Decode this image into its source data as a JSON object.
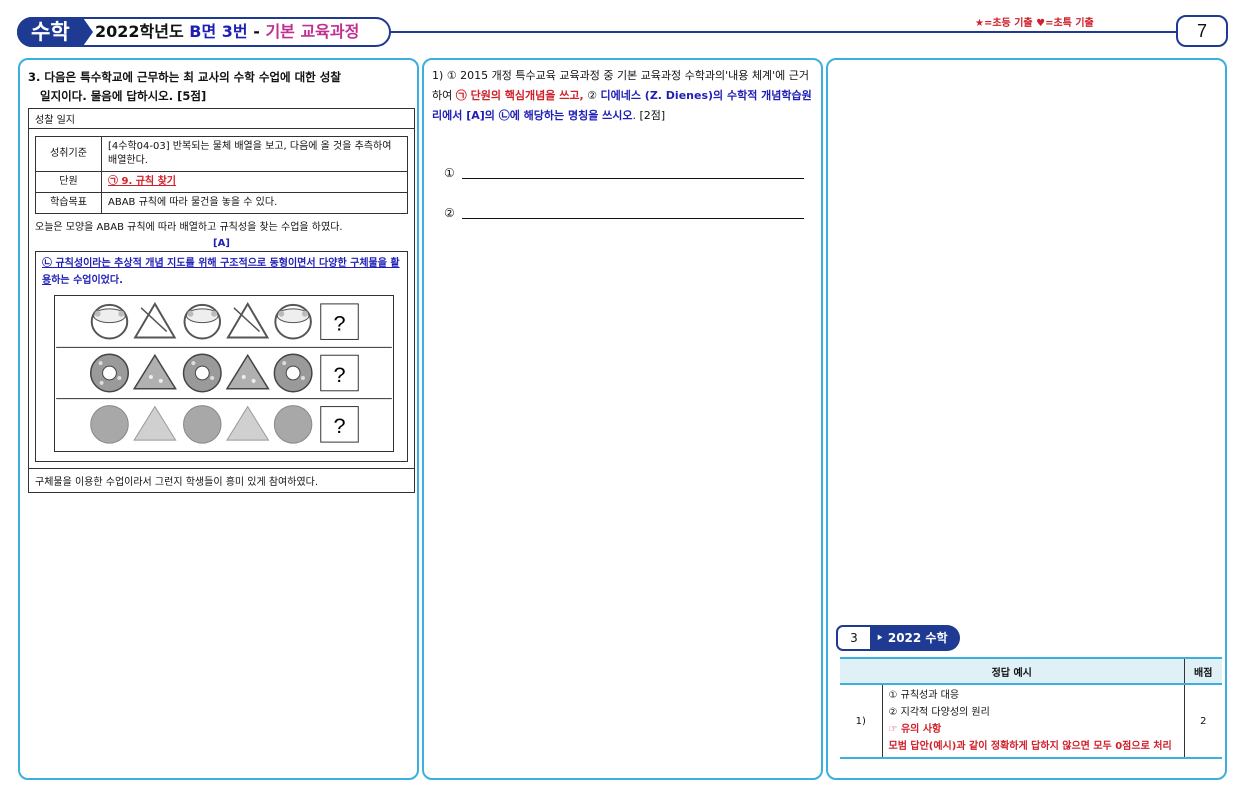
{
  "header": {
    "subject": "수학",
    "year": "2022학년도",
    "paper": "B면",
    "question_no": "3번",
    "dash": "-",
    "category": "기본 교육과정",
    "legend": "★=초등 기출 ♥=초특 기출",
    "page_number": "7"
  },
  "question": {
    "title_line1": "3. 다음은 특수학교에 근무하는 최 교사의 수학 수업에 대한 성찰",
    "title_line2": "일지이다. 물음에 답하시오. [5점]",
    "journal_caption": "성찰 일지",
    "rows": [
      {
        "key": "성취기준",
        "value": "[4수학04-03] 반복되는 물체 배열을 보고, 다음에 올 것을 추측하여 배열한다."
      },
      {
        "key": "단원",
        "value": "㉠ 9. 규칙 찾기"
      },
      {
        "key": "학습목표",
        "value": "ABAB 규칙에 따라 물건을 놓을 수 있다."
      }
    ],
    "narrative": "오늘은 모양을 ABAB 규칙에 따라 배열하고 규칙성을 찾는 수업을 하였다.",
    "a_label": "[A]",
    "a_text_underlined": "㉡ 규칙성이라는 추상적 개념 지도를 위해 구조적으로 동형이면서 다양한 구체물을 활용",
    "a_text_rest": "하는 수업이었다.",
    "question_mark": "?",
    "closing": "구체물을 이용한 수업이라서 그런지 학생들이 흥미 있게 참여하였다."
  },
  "subquestion": {
    "p1": "1) ① 2015 개정 특수교육 교육과정 중 기본 교육과정 수학과의'내용 체계'에 근거하여 ",
    "red": "㉠ 단원의 핵심개념을 쓰고,",
    "p2": " ② ",
    "blue": "디에네스 (Z. Dienes)의 수학적 개념학습원리에서 [A]의 ㉡에 해당하는 명칭을 쓰시오",
    "p3": ". [2점]",
    "ans1": "①",
    "ans2": "②"
  },
  "solution": {
    "num": "3",
    "title": "‣ 2022 수학",
    "col_answer": "정답 예시",
    "col_score": "배점",
    "row_no": "1)",
    "line1": "① 규칙성과 대응",
    "line2": "② 지각적 다양성의 원리",
    "note_label": "☞ 유의 사항",
    "note_text": "모범 답안(예시)과 같이 정확하게 답하지 않으면 모두 0점으로 처리",
    "score": "2"
  },
  "icons": [
    "tambourine",
    "triangle",
    "donut",
    "sandwich",
    "circle",
    "triangle-shape"
  ],
  "colors": {
    "brand": "#1f3a93",
    "panel_border": "#3bb0dc",
    "red": "#d0202a",
    "blue": "#1f1fb5"
  }
}
